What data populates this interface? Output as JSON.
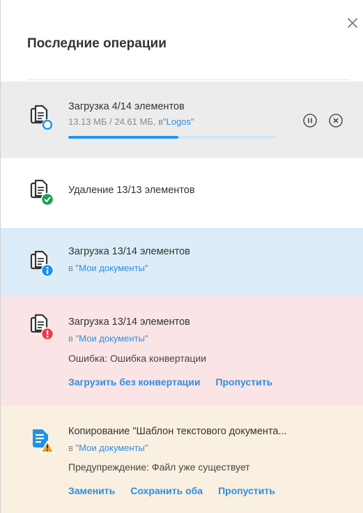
{
  "panel": {
    "title": "Последние операции"
  },
  "operations": [
    {
      "type": "upload-progress",
      "background": "#ececec",
      "title": "Загрузка 4/14 элементов",
      "size": "13.13 МБ / 24.61 МБ,",
      "dest_prefix": "в",
      "dest": "\"Logos\"",
      "progress": 0.53,
      "icon": "document-upload-icon"
    },
    {
      "type": "delete-done",
      "background": "#ffffff",
      "title": "Удаление 13/13 элементов",
      "icon": "document-check-icon"
    },
    {
      "type": "upload-info",
      "background": "#dcedf9",
      "title": "Загрузка 13/14 элементов",
      "dest_prefix": "в",
      "dest": "\"Мои документы\"",
      "icon": "document-info-icon"
    },
    {
      "type": "upload-error",
      "background": "#fbe4e6",
      "title": "Загрузка 13/14 элементов",
      "dest_prefix": "в",
      "dest": "\"Мои документы\"",
      "message": "Ошибка: Ошибка конвертации",
      "actions": [
        "Загрузить без конвертации",
        "Пропустить"
      ],
      "icon": "document-error-icon"
    },
    {
      "type": "copy-warning",
      "background": "#f9f0e1",
      "title": "Копирование \"Шаблон текстового документа...",
      "dest_prefix": "в",
      "dest": "\"Мои документы\"",
      "message": "Предупреждение: Файл уже существует",
      "actions": [
        "Заменить",
        "Сохранить оба",
        "Пропустить"
      ],
      "icon": "text-document-warning-icon"
    }
  ],
  "colors": {
    "accent": "#2d8ee0",
    "progress": "#2196f3",
    "success": "#1f9e55",
    "info": "#2190e8",
    "error": "#ef3a46",
    "warning": "#f2a21d"
  }
}
